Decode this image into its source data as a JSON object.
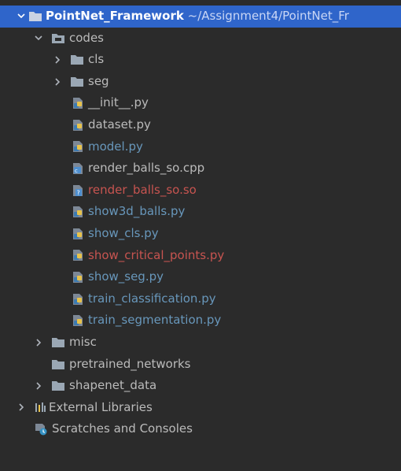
{
  "project": {
    "name": "PointNet_Framework",
    "path": "~/Assignment4/PointNet_Fr"
  },
  "tree": {
    "codes": "codes",
    "cls": "cls",
    "seg": "seg",
    "files": {
      "init": "__init__.py",
      "dataset": "dataset.py",
      "model": "model.py",
      "render_cpp": "render_balls_so.cpp",
      "render_so": "render_balls_so.so",
      "show3d": "show3d_balls.py",
      "show_cls": "show_cls.py",
      "show_critical": "show_critical_points.py",
      "show_seg": "show_seg.py",
      "train_cls": "train_classification.py",
      "train_seg": "train_segmentation.py"
    },
    "misc": "misc",
    "pretrained": "pretrained_networks",
    "shapenet": "shapenet_data",
    "external_libraries": "External Libraries",
    "scratches": "Scratches and Consoles"
  },
  "colors": {
    "background": "#2b2b2b",
    "selection": "#2f65ca",
    "modified_blue": "#6897bb",
    "unversioned_red": "#c75450",
    "default_text": "#bbbbbb"
  }
}
